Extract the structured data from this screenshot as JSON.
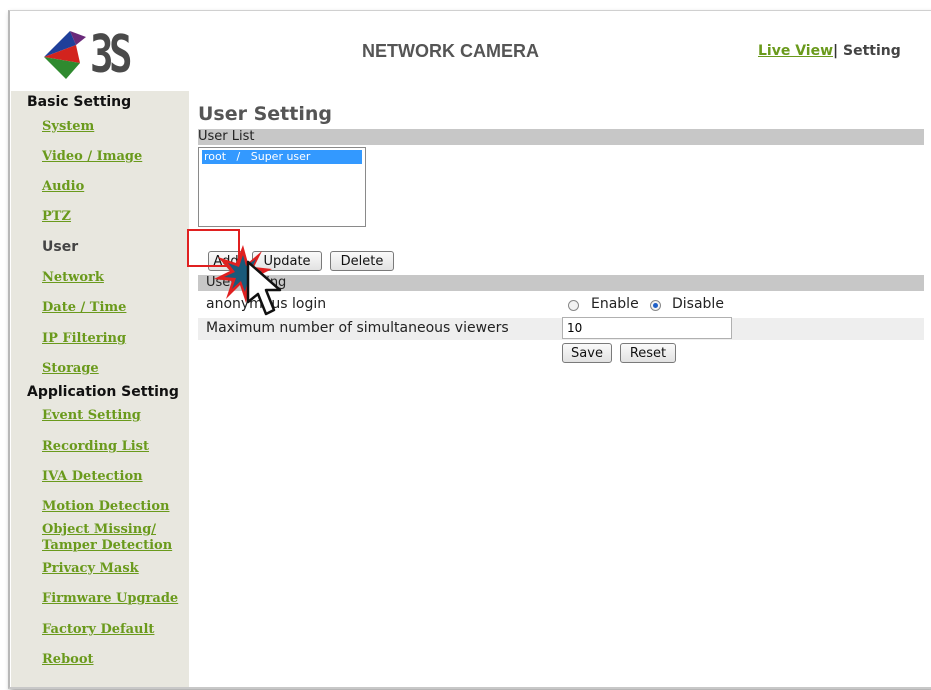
{
  "header": {
    "logo_text": "3S",
    "title": "NETWORK CAMERA",
    "live_view": "Live View",
    "separator": "|",
    "setting": "Setting"
  },
  "sidebar": {
    "basic_heading": "Basic Setting",
    "basic_items": [
      {
        "label": "System"
      },
      {
        "label": "Video / Image"
      },
      {
        "label": "Audio"
      },
      {
        "label": "PTZ"
      },
      {
        "label": "User",
        "current": true
      },
      {
        "label": "Network"
      },
      {
        "label": "Date / Time"
      },
      {
        "label": "IP Filtering"
      },
      {
        "label": "Storage"
      }
    ],
    "app_heading": "Application Setting",
    "app_items": [
      {
        "label": "Event Setting"
      },
      {
        "label": "Recording List"
      },
      {
        "label": "IVA Detection"
      },
      {
        "label": "Motion Detection"
      },
      {
        "label": "Object Missing/"
      },
      {
        "label": "Tamper Detection"
      },
      {
        "label": "Privacy Mask"
      },
      {
        "label": "Firmware Upgrade"
      },
      {
        "label": "Factory Default"
      },
      {
        "label": "Reboot"
      }
    ]
  },
  "main": {
    "title": "User Setting",
    "user_list_heading": "User List",
    "users": [
      "root   /   Super user"
    ],
    "buttons": {
      "add": "Add",
      "update": "Update",
      "delete": "Delete"
    },
    "user_setting_heading": "User Setting",
    "anonymous_label": "anonymous login",
    "enable_label": "Enable",
    "disable_label": "Disable",
    "anonymous_value": "Disable",
    "max_viewers_label": "Maximum number of simultaneous viewers",
    "max_viewers_value": "10",
    "save": "Save",
    "reset": "Reset"
  },
  "colors": {
    "link": "#6a9a1c",
    "section_bar": "#c7c7c7",
    "sidebar_bg": "#e8e7df",
    "selection": "#3399ff",
    "highlight": "#e02020"
  }
}
